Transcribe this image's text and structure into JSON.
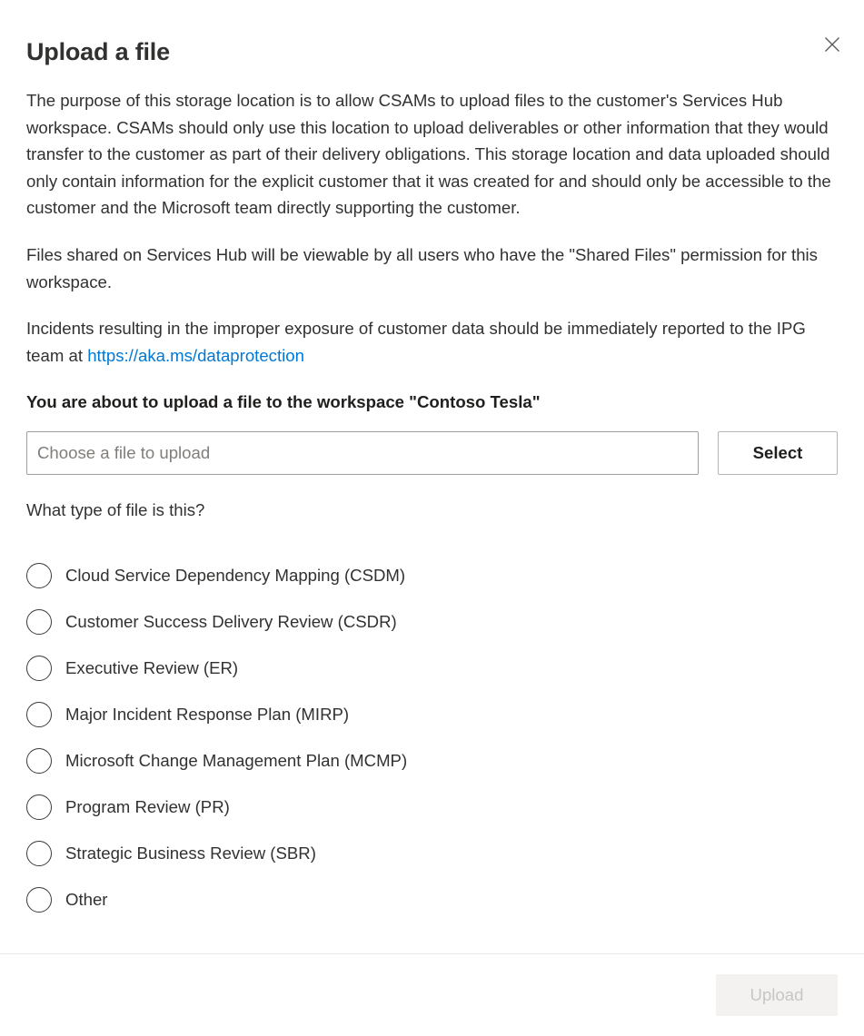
{
  "dialog": {
    "title": "Upload a file",
    "close_icon": "close-icon",
    "paragraphs": [
      "The purpose of this storage location is to allow CSAMs to upload files to the customer's Services Hub workspace. CSAMs should only use this location to upload deliverables or other information that they would transfer to the customer as part of their delivery obligations. This storage location and data uploaded should only contain information for the explicit customer that it was created for and should only be accessible to the customer and the Microsoft team directly supporting the customer.",
      "Files shared on Services Hub will be viewable by all users who have the \"Shared Files\" permission for this workspace."
    ],
    "incident_paragraph": {
      "text_before": "Incidents resulting in the improper exposure of customer data should be immediately reported to the IPG team at ",
      "link_text": "https://aka.ms/dataprotection",
      "link_color": "#0078d4"
    },
    "workspace_line": "You are about to upload a file to the workspace \"Contoso Tesla\""
  },
  "file_picker": {
    "placeholder": "Choose a file to upload",
    "value": "",
    "select_label": "Select"
  },
  "file_type": {
    "question": "What type of file is this?",
    "selected": null,
    "options": [
      {
        "label": "Cloud Service Dependency Mapping (CSDM)",
        "checked": false
      },
      {
        "label": "Customer Success Delivery Review (CSDR)",
        "checked": false
      },
      {
        "label": "Executive Review (ER)",
        "checked": false
      },
      {
        "label": "Major Incident Response Plan (MIRP)",
        "checked": false
      },
      {
        "label": "Microsoft Change Management Plan (MCMP)",
        "checked": false
      },
      {
        "label": "Program Review (PR)",
        "checked": false
      },
      {
        "label": "Strategic Business Review (SBR)",
        "checked": false
      },
      {
        "label": "Other",
        "checked": false
      }
    ]
  },
  "footer": {
    "upload_label": "Upload",
    "upload_disabled": true
  }
}
